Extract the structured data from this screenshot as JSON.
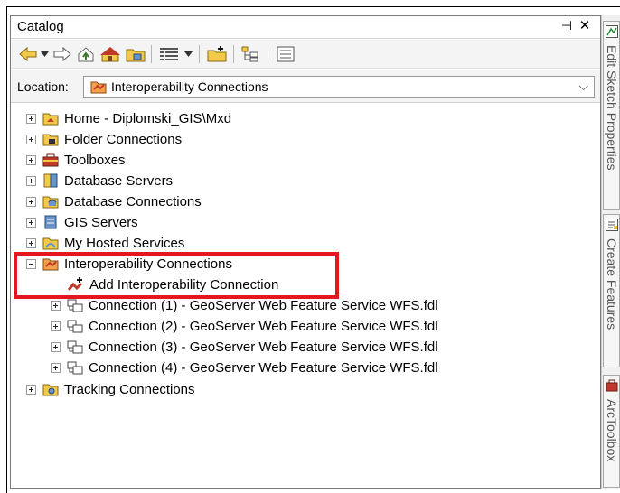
{
  "panel": {
    "title": "Catalog",
    "pin_glyph": "⊣",
    "close_glyph": "✕"
  },
  "toolbar": {
    "buttons": [
      {
        "name": "back-arrow-icon"
      },
      {
        "name": "back-dropdown-icon"
      },
      {
        "name": "forward-arrow-icon"
      },
      {
        "name": "up-one-level-icon"
      },
      {
        "name": "home-icon"
      },
      {
        "name": "connect-folder-icon"
      },
      {
        "name": "view-options-icon"
      },
      {
        "name": "view-dropdown-icon"
      },
      {
        "name": "new-item-icon"
      },
      {
        "name": "tree-view-icon"
      },
      {
        "name": "options-icon"
      }
    ]
  },
  "location": {
    "label": "Location:",
    "value": "Interoperability Connections"
  },
  "tree": {
    "items": [
      {
        "label": "Home - Diplomski_GIS\\Mxd",
        "icon": "home-folder-icon"
      },
      {
        "label": "Folder Connections",
        "icon": "folder-connections-icon"
      },
      {
        "label": "Toolboxes",
        "icon": "toolboxes-icon"
      },
      {
        "label": "Database Servers",
        "icon": "database-servers-icon"
      },
      {
        "label": "Database Connections",
        "icon": "database-connections-icon"
      },
      {
        "label": "GIS Servers",
        "icon": "gis-servers-icon"
      },
      {
        "label": "My Hosted Services",
        "icon": "hosted-services-icon"
      },
      {
        "label": "Interoperability Connections",
        "icon": "interoperability-icon"
      },
      {
        "label": "Add Interoperability Connection",
        "icon": "add-connection-icon"
      },
      {
        "label": "Connection (1) - GeoServer Web Feature Service WFS.fdl",
        "icon": "connection-icon"
      },
      {
        "label": "Connection (2) - GeoServer Web Feature Service WFS.fdl",
        "icon": "connection-icon"
      },
      {
        "label": "Connection (3) - GeoServer Web Feature Service WFS.fdl",
        "icon": "connection-icon"
      },
      {
        "label": "Connection (4) - GeoServer Web Feature Service WFS.fdl",
        "icon": "connection-icon"
      },
      {
        "label": "Tracking Connections",
        "icon": "tracking-icon"
      }
    ]
  },
  "sidebar": {
    "tabs": [
      {
        "label": "Edit Sketch Properties"
      },
      {
        "label": "Create Features"
      },
      {
        "label": "ArcToolbox"
      }
    ]
  },
  "colors": {
    "highlight": "#e4161f"
  }
}
